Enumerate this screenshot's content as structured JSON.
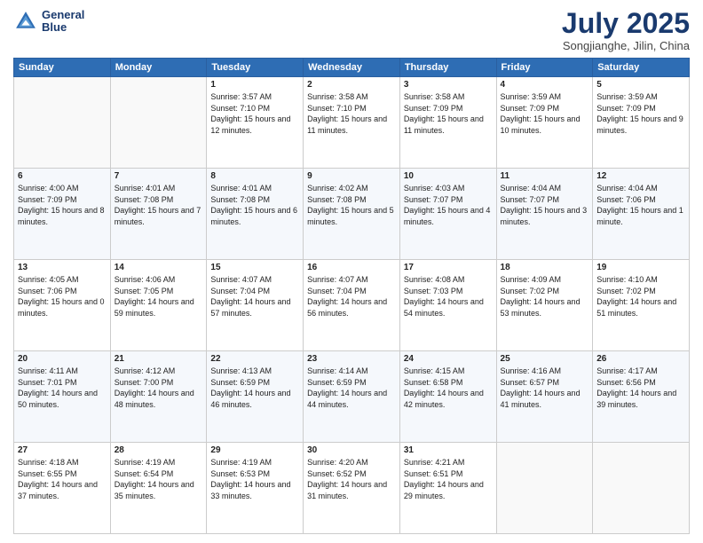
{
  "header": {
    "logo_line1": "General",
    "logo_line2": "Blue",
    "month": "July 2025",
    "location": "Songjianghe, Jilin, China"
  },
  "days_of_week": [
    "Sunday",
    "Monday",
    "Tuesday",
    "Wednesday",
    "Thursday",
    "Friday",
    "Saturday"
  ],
  "weeks": [
    [
      {
        "day": "",
        "info": ""
      },
      {
        "day": "",
        "info": ""
      },
      {
        "day": "1",
        "info": "Sunrise: 3:57 AM\nSunset: 7:10 PM\nDaylight: 15 hours and 12 minutes."
      },
      {
        "day": "2",
        "info": "Sunrise: 3:58 AM\nSunset: 7:10 PM\nDaylight: 15 hours and 11 minutes."
      },
      {
        "day": "3",
        "info": "Sunrise: 3:58 AM\nSunset: 7:09 PM\nDaylight: 15 hours and 11 minutes."
      },
      {
        "day": "4",
        "info": "Sunrise: 3:59 AM\nSunset: 7:09 PM\nDaylight: 15 hours and 10 minutes."
      },
      {
        "day": "5",
        "info": "Sunrise: 3:59 AM\nSunset: 7:09 PM\nDaylight: 15 hours and 9 minutes."
      }
    ],
    [
      {
        "day": "6",
        "info": "Sunrise: 4:00 AM\nSunset: 7:09 PM\nDaylight: 15 hours and 8 minutes."
      },
      {
        "day": "7",
        "info": "Sunrise: 4:01 AM\nSunset: 7:08 PM\nDaylight: 15 hours and 7 minutes."
      },
      {
        "day": "8",
        "info": "Sunrise: 4:01 AM\nSunset: 7:08 PM\nDaylight: 15 hours and 6 minutes."
      },
      {
        "day": "9",
        "info": "Sunrise: 4:02 AM\nSunset: 7:08 PM\nDaylight: 15 hours and 5 minutes."
      },
      {
        "day": "10",
        "info": "Sunrise: 4:03 AM\nSunset: 7:07 PM\nDaylight: 15 hours and 4 minutes."
      },
      {
        "day": "11",
        "info": "Sunrise: 4:04 AM\nSunset: 7:07 PM\nDaylight: 15 hours and 3 minutes."
      },
      {
        "day": "12",
        "info": "Sunrise: 4:04 AM\nSunset: 7:06 PM\nDaylight: 15 hours and 1 minute."
      }
    ],
    [
      {
        "day": "13",
        "info": "Sunrise: 4:05 AM\nSunset: 7:06 PM\nDaylight: 15 hours and 0 minutes."
      },
      {
        "day": "14",
        "info": "Sunrise: 4:06 AM\nSunset: 7:05 PM\nDaylight: 14 hours and 59 minutes."
      },
      {
        "day": "15",
        "info": "Sunrise: 4:07 AM\nSunset: 7:04 PM\nDaylight: 14 hours and 57 minutes."
      },
      {
        "day": "16",
        "info": "Sunrise: 4:07 AM\nSunset: 7:04 PM\nDaylight: 14 hours and 56 minutes."
      },
      {
        "day": "17",
        "info": "Sunrise: 4:08 AM\nSunset: 7:03 PM\nDaylight: 14 hours and 54 minutes."
      },
      {
        "day": "18",
        "info": "Sunrise: 4:09 AM\nSunset: 7:02 PM\nDaylight: 14 hours and 53 minutes."
      },
      {
        "day": "19",
        "info": "Sunrise: 4:10 AM\nSunset: 7:02 PM\nDaylight: 14 hours and 51 minutes."
      }
    ],
    [
      {
        "day": "20",
        "info": "Sunrise: 4:11 AM\nSunset: 7:01 PM\nDaylight: 14 hours and 50 minutes."
      },
      {
        "day": "21",
        "info": "Sunrise: 4:12 AM\nSunset: 7:00 PM\nDaylight: 14 hours and 48 minutes."
      },
      {
        "day": "22",
        "info": "Sunrise: 4:13 AM\nSunset: 6:59 PM\nDaylight: 14 hours and 46 minutes."
      },
      {
        "day": "23",
        "info": "Sunrise: 4:14 AM\nSunset: 6:59 PM\nDaylight: 14 hours and 44 minutes."
      },
      {
        "day": "24",
        "info": "Sunrise: 4:15 AM\nSunset: 6:58 PM\nDaylight: 14 hours and 42 minutes."
      },
      {
        "day": "25",
        "info": "Sunrise: 4:16 AM\nSunset: 6:57 PM\nDaylight: 14 hours and 41 minutes."
      },
      {
        "day": "26",
        "info": "Sunrise: 4:17 AM\nSunset: 6:56 PM\nDaylight: 14 hours and 39 minutes."
      }
    ],
    [
      {
        "day": "27",
        "info": "Sunrise: 4:18 AM\nSunset: 6:55 PM\nDaylight: 14 hours and 37 minutes."
      },
      {
        "day": "28",
        "info": "Sunrise: 4:19 AM\nSunset: 6:54 PM\nDaylight: 14 hours and 35 minutes."
      },
      {
        "day": "29",
        "info": "Sunrise: 4:19 AM\nSunset: 6:53 PM\nDaylight: 14 hours and 33 minutes."
      },
      {
        "day": "30",
        "info": "Sunrise: 4:20 AM\nSunset: 6:52 PM\nDaylight: 14 hours and 31 minutes."
      },
      {
        "day": "31",
        "info": "Sunrise: 4:21 AM\nSunset: 6:51 PM\nDaylight: 14 hours and 29 minutes."
      },
      {
        "day": "",
        "info": ""
      },
      {
        "day": "",
        "info": ""
      }
    ]
  ]
}
